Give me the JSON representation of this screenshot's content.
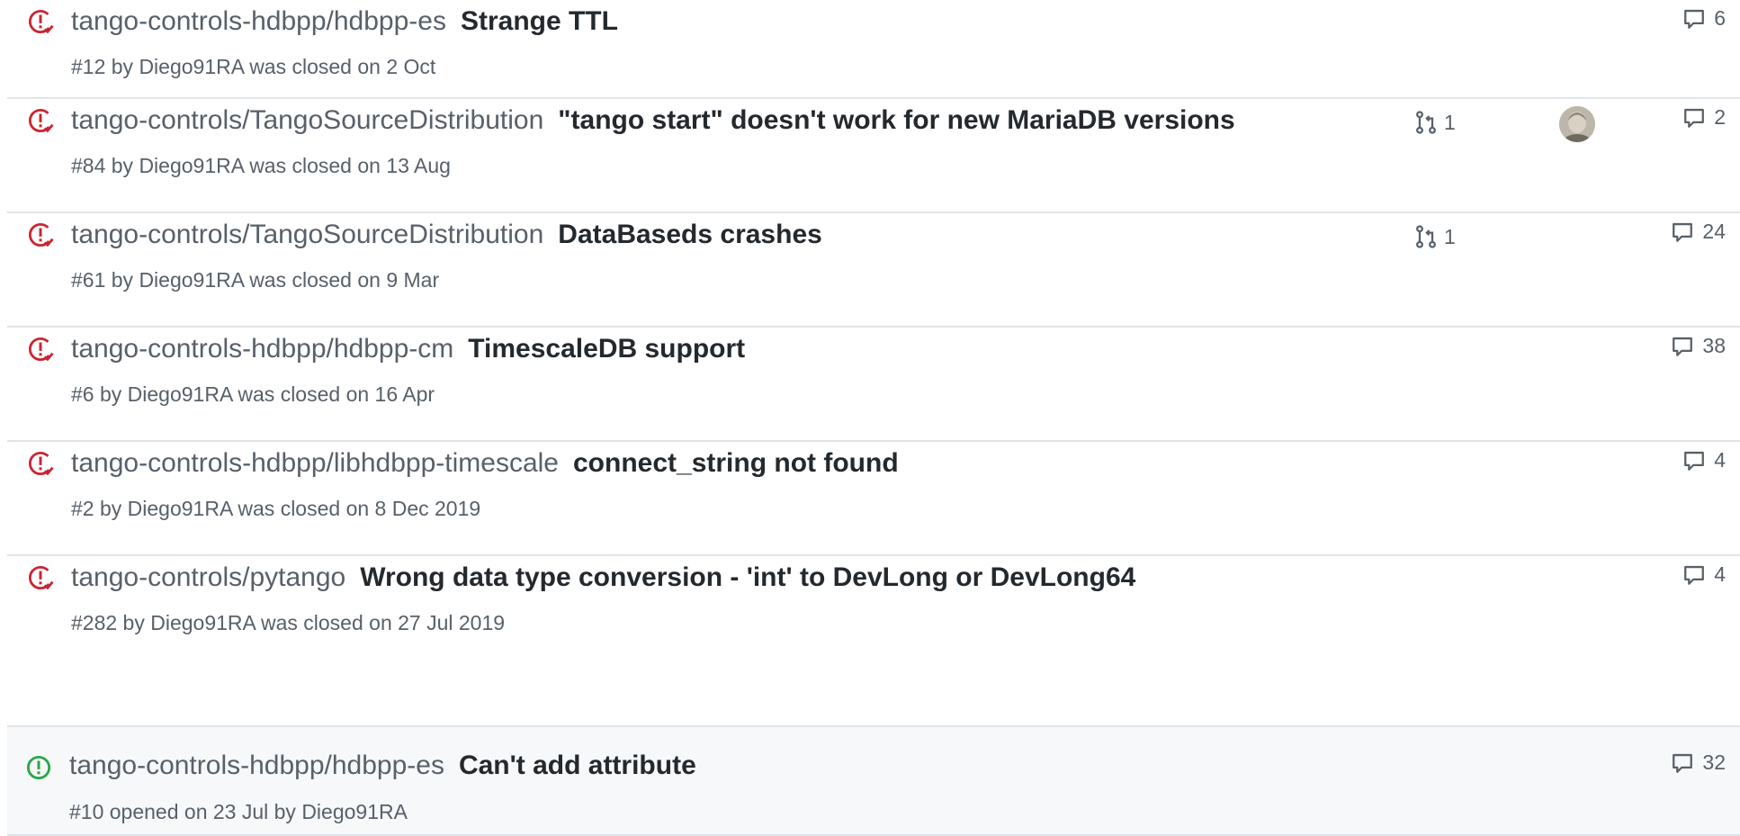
{
  "colors": {
    "closed": "#cb2431",
    "open": "#28a745",
    "muted": "#586069",
    "text": "#24292e"
  },
  "issues": [
    {
      "state": "closed",
      "repo": "tango-controls-hdbpp/hdbpp-es",
      "title": "Strange TTL",
      "meta": "#12 by Diego91RA was closed on 2 Oct",
      "linked_prs": "",
      "has_avatar": false,
      "comments": "6"
    },
    {
      "state": "closed",
      "repo": "tango-controls/TangoSourceDistribution",
      "title": "\"tango start\" doesn't work for new MariaDB versions",
      "meta": "#84 by Diego91RA was closed on 13 Aug",
      "linked_prs": "1",
      "has_avatar": true,
      "comments": "2"
    },
    {
      "state": "closed",
      "repo": "tango-controls/TangoSourceDistribution",
      "title": "DataBaseds crashes",
      "meta": "#61 by Diego91RA was closed on 9 Mar",
      "linked_prs": "1",
      "has_avatar": false,
      "comments": "24"
    },
    {
      "state": "closed",
      "repo": "tango-controls-hdbpp/hdbpp-cm",
      "title": "TimescaleDB support",
      "meta": "#6 by Diego91RA was closed on 16 Apr",
      "linked_prs": "",
      "has_avatar": false,
      "comments": "38"
    },
    {
      "state": "closed",
      "repo": "tango-controls-hdbpp/libhdbpp-timescale",
      "title": "connect_string not found",
      "meta": "#2 by Diego91RA was closed on 8 Dec 2019",
      "linked_prs": "",
      "has_avatar": false,
      "comments": "4"
    },
    {
      "state": "closed",
      "repo": "tango-controls/pytango",
      "title": "Wrong data type conversion - 'int' to DevLong or DevLong64",
      "meta": "#282 by Diego91RA was closed on 27 Jul 2019",
      "linked_prs": "",
      "has_avatar": false,
      "comments": "4"
    },
    {
      "state": "open",
      "repo": "tango-controls-hdbpp/hdbpp-es",
      "title": "Can't add attribute",
      "meta": "#10 opened on 23 Jul by Diego91RA",
      "linked_prs": "",
      "has_avatar": false,
      "comments": "32"
    }
  ]
}
